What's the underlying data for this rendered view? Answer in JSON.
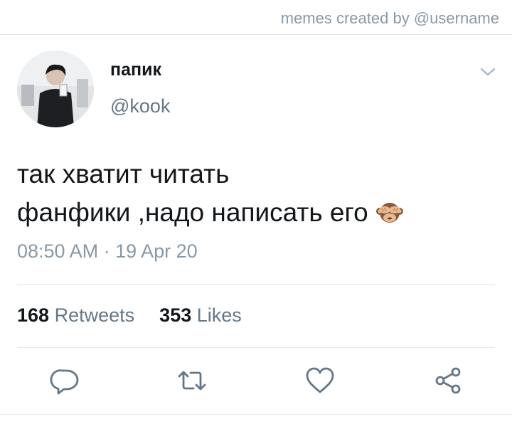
{
  "header": {
    "credit": "memes created by @username"
  },
  "tweet": {
    "display_name": "папик",
    "handle": "@kook",
    "text_lines": [
      "так хватит читать",
      "фанфики ,надо написать его"
    ],
    "emoji": "see-no-evil-monkey",
    "timestamp": "08:50 AM · 19 Apr 20"
  },
  "stats": {
    "retweets_count": "168",
    "retweets_label": "Retweets",
    "likes_count": "353",
    "likes_label": "Likes"
  },
  "actions": [
    {
      "icon": "reply-icon"
    },
    {
      "icon": "retweet-icon"
    },
    {
      "icon": "like-icon"
    },
    {
      "icon": "share-icon"
    }
  ],
  "colors": {
    "primary_text": "#14171a",
    "secondary_text": "#657786",
    "muted_text": "#8899a6",
    "icon": "#657786",
    "divider": "#e1e8ed"
  }
}
